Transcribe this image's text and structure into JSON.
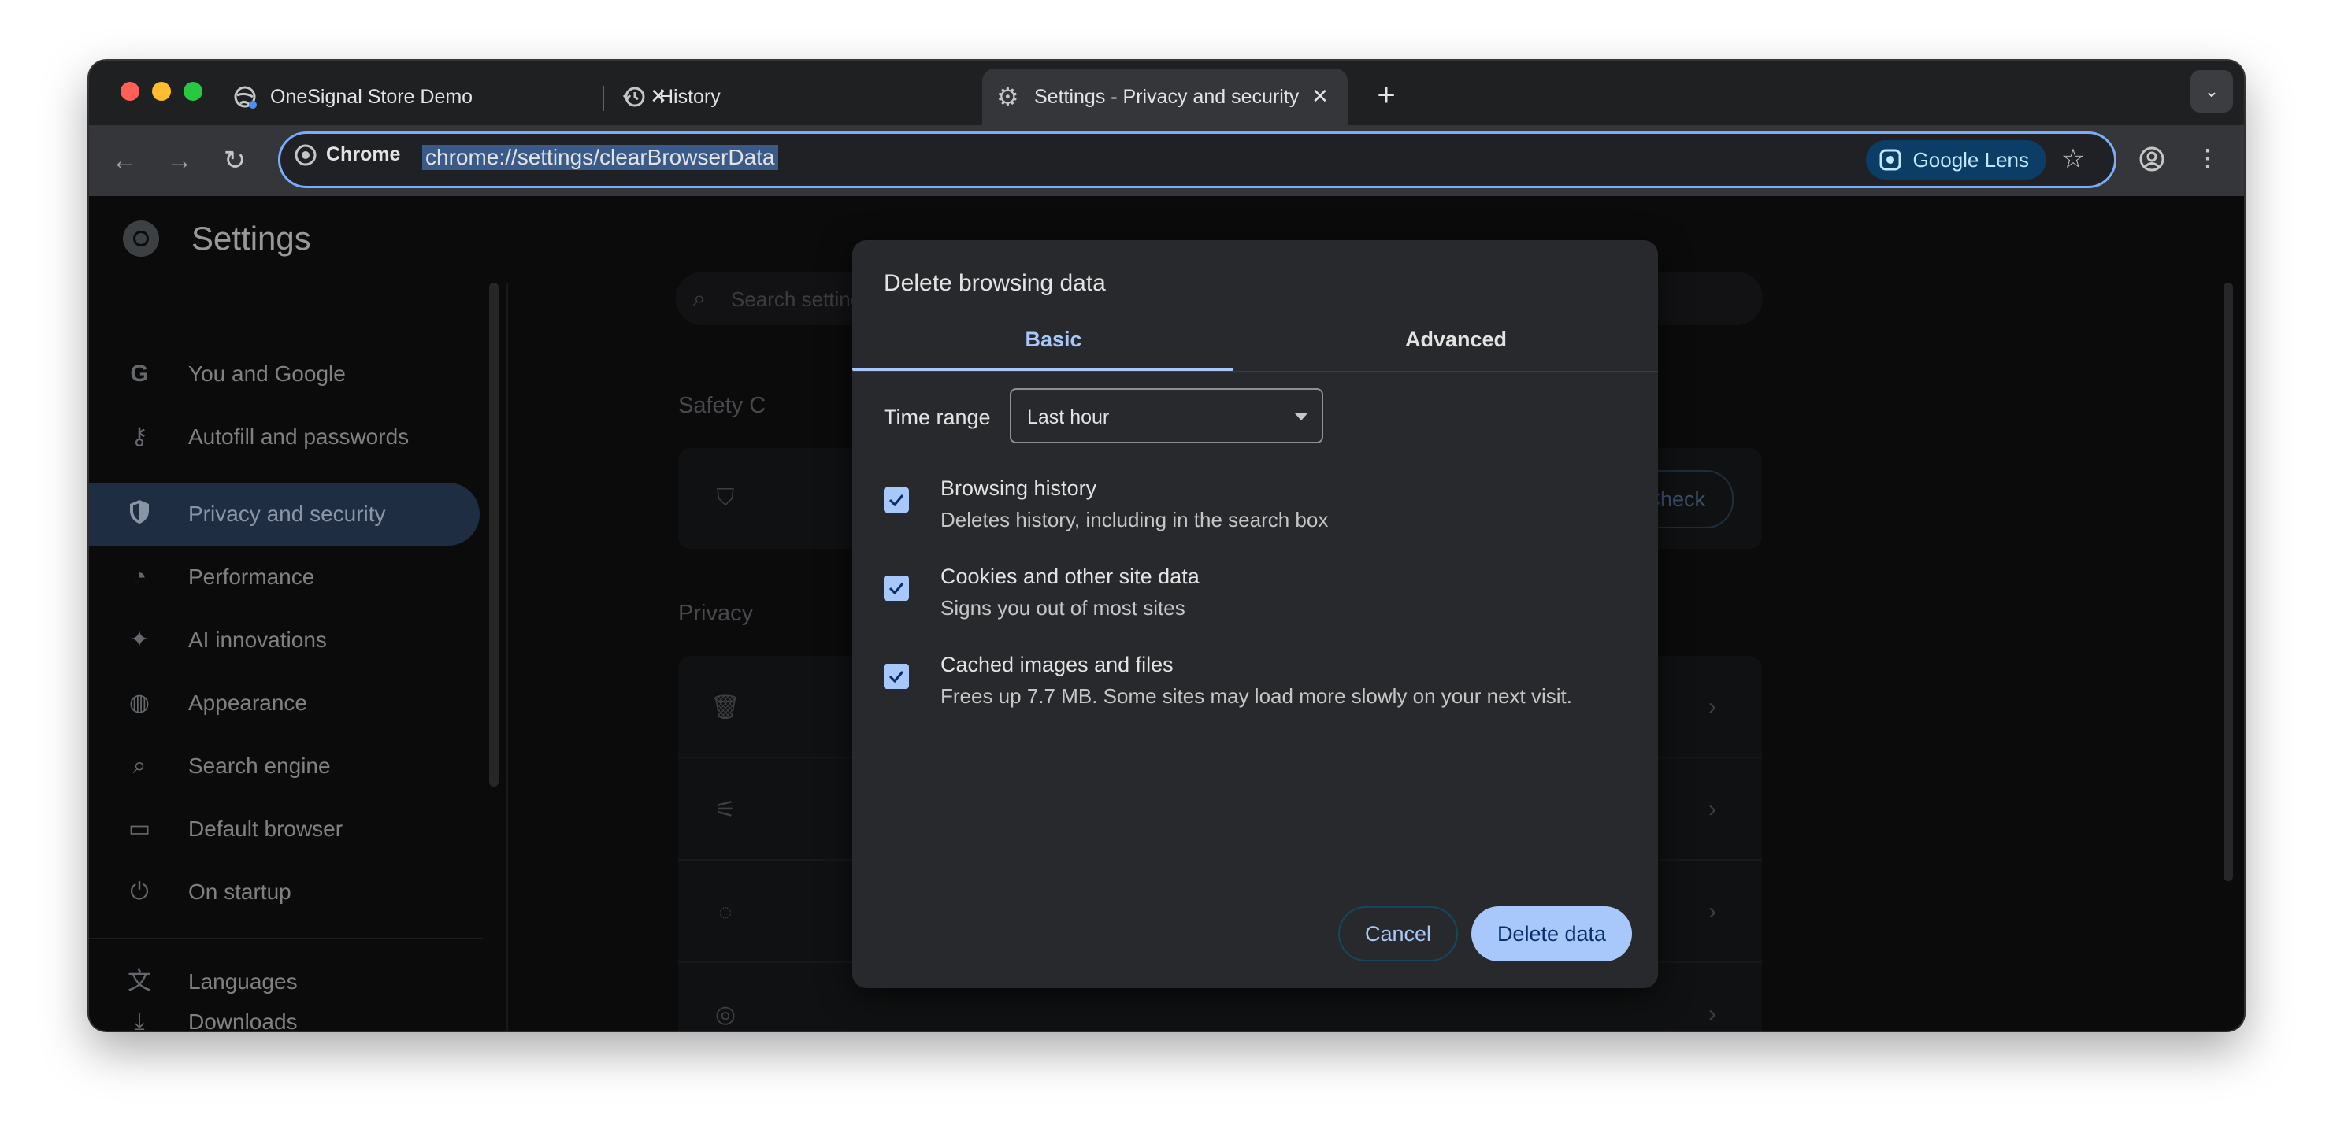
{
  "tabs": [
    {
      "label": "OneSignal Store Demo"
    },
    {
      "label": "History"
    },
    {
      "label": "Settings - Privacy and security"
    }
  ],
  "omnibox": {
    "chip_label": "Chrome",
    "url": "chrome://settings/clearBrowserData",
    "lens_label": "Google Lens"
  },
  "sidebar": {
    "title": "Settings",
    "items": [
      {
        "label": "You and Google",
        "icon": "google-icon"
      },
      {
        "label": "Autofill and passwords",
        "icon": "key-icon"
      },
      {
        "label": "Privacy and security",
        "icon": "shield-icon",
        "active": true
      },
      {
        "label": "Performance",
        "icon": "speedometer-icon"
      },
      {
        "label": "AI innovations",
        "icon": "sparkle-icon"
      },
      {
        "label": "Appearance",
        "icon": "palette-icon"
      },
      {
        "label": "Search engine",
        "icon": "search-icon"
      },
      {
        "label": "Default browser",
        "icon": "browser-window-icon"
      },
      {
        "label": "On startup",
        "icon": "power-icon"
      },
      {
        "label": "Languages",
        "icon": "translate-icon"
      },
      {
        "label": "Downloads",
        "icon": "download-icon"
      }
    ]
  },
  "main": {
    "search_placeholder": "Search settings",
    "safety_section": "Safety C",
    "safety_check_button": "Safety Check",
    "privacy_section": "Privacy"
  },
  "dialog": {
    "title": "Delete browsing data",
    "tabs": {
      "basic": "Basic",
      "advanced": "Advanced"
    },
    "time_range_label": "Time range",
    "time_range_value": "Last hour",
    "options": [
      {
        "title": "Browsing history",
        "desc": "Deletes history, including in the search box",
        "checked": true
      },
      {
        "title": "Cookies and other site data",
        "desc": "Signs you out of most sites",
        "checked": true
      },
      {
        "title": "Cached images and files",
        "desc": "Frees up 7.7 MB. Some sites may load more slowly on your next visit.",
        "checked": true
      }
    ],
    "cancel_label": "Cancel",
    "delete_label": "Delete data"
  },
  "colors": {
    "accent": "#a8c7fa",
    "dialog_bg": "#28292c",
    "active_nav": "#2f4566"
  }
}
